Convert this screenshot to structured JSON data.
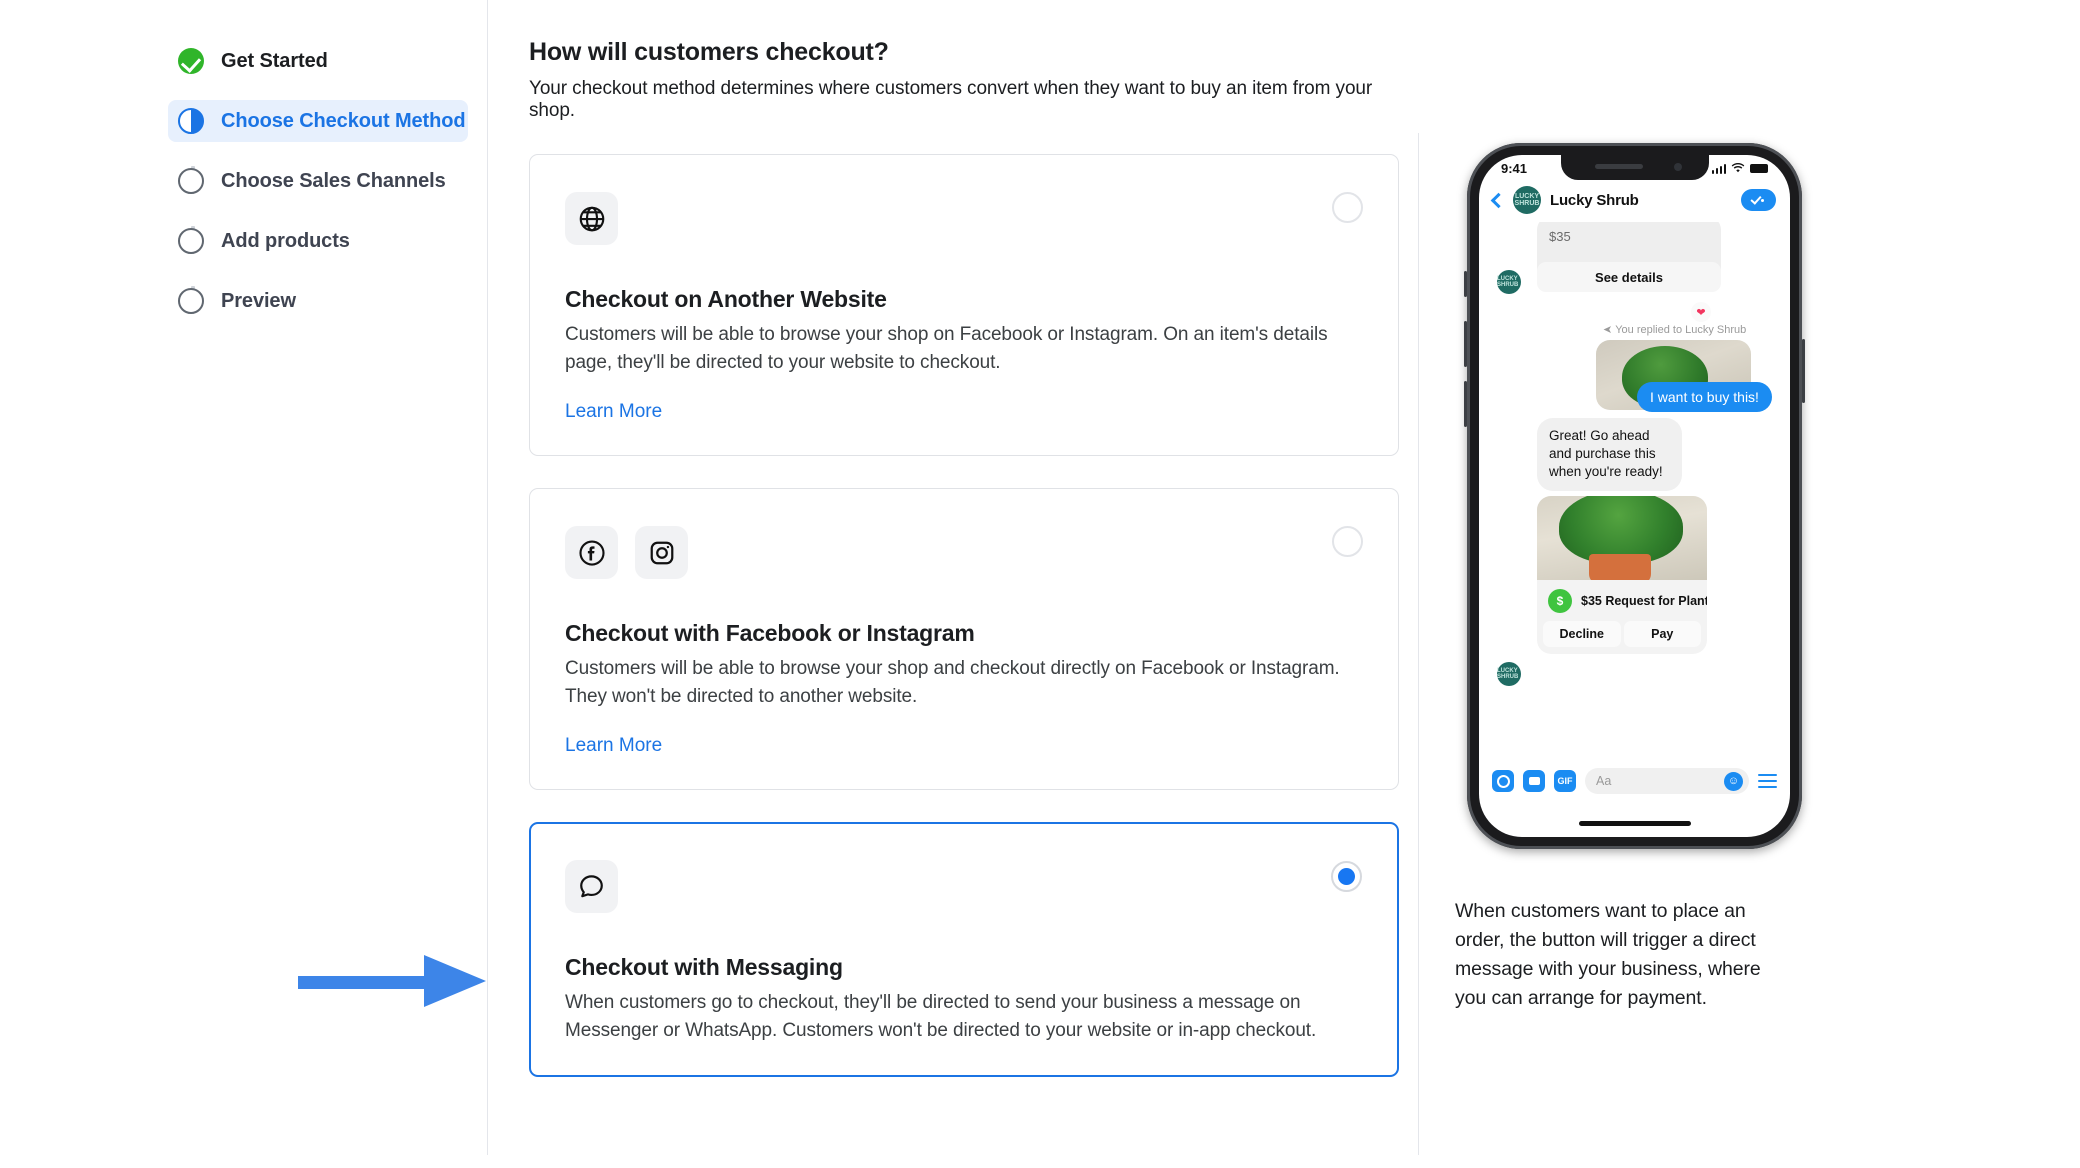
{
  "stepper": {
    "steps": [
      {
        "label": "Get Started",
        "state": "done"
      },
      {
        "label": "Choose Checkout Method",
        "state": "active"
      },
      {
        "label": "Choose Sales Channels",
        "state": "todo"
      },
      {
        "label": "Add products",
        "state": "todo"
      },
      {
        "label": "Preview",
        "state": "todo"
      }
    ]
  },
  "main": {
    "heading": "How will customers checkout?",
    "subheading": "Your checkout method determines where customers convert when they want to buy an item from your shop.",
    "options": [
      {
        "id": "another-website",
        "icons": [
          "globe-icon"
        ],
        "title": "Checkout on Another Website",
        "description": "Customers will be able to browse your shop on Facebook or Instagram. On an item's details page, they'll be directed to your website to checkout.",
        "learn_more": "Learn More",
        "selected": false
      },
      {
        "id": "facebook-instagram",
        "icons": [
          "facebook-icon",
          "instagram-icon"
        ],
        "title": "Checkout with Facebook or Instagram",
        "description": "Customers will be able to browse your shop and checkout directly on Facebook or Instagram. They won't be directed to another website.",
        "learn_more": "Learn More",
        "selected": false
      },
      {
        "id": "messaging",
        "icons": [
          "message-bubble-icon"
        ],
        "title": "Checkout with Messaging",
        "description": "When customers go to checkout, they'll be directed to send your business a message on Messenger or WhatsApp. Customers won't be directed to your website or in-app checkout.",
        "learn_more": "",
        "selected": true
      }
    ]
  },
  "preview": {
    "phone": {
      "status_time": "9:41",
      "shop_name": "Lucky Shrub",
      "avatar_text": "LUCKY SHRUB",
      "product_price": "$35",
      "see_details": "See details",
      "replied_label": "You replied to Lucky Shrub",
      "reaction": "❤",
      "outgoing_message": "I want to buy this!",
      "incoming_message": "Great! Go ahead and purchase this when you're ready!",
      "payment_request": "$35 Request for Plant",
      "money_glyph": "$",
      "decline_label": "Decline",
      "pay_label": "Pay",
      "composer_placeholder": "Aa",
      "gif_label": "GIF",
      "emoji_glyph": "☺"
    },
    "caption": "When customers want to place an order, the button will trigger a direct message with your business, where you can arrange for payment."
  },
  "annotation": {
    "arrow": "right-arrow-annotation",
    "color": "#3d85e8"
  },
  "colors": {
    "accent_blue": "#1b74e4",
    "selected_radio": "#1877f2",
    "done_green": "#30b52a",
    "messenger_blue": "#1b8cf2",
    "arrow_blue": "#3d85e8"
  }
}
